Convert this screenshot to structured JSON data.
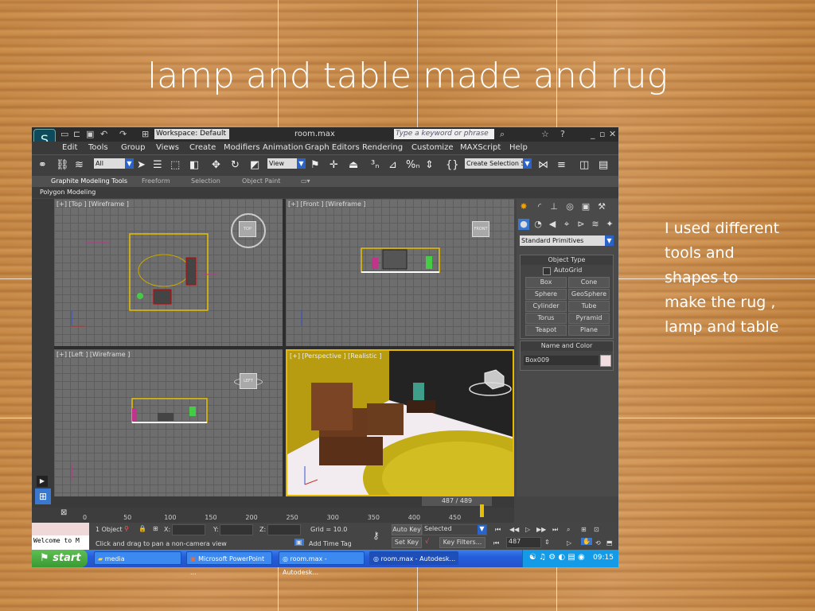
{
  "slide": {
    "title": "lamp and table made and rug",
    "note": "I used different tools and shapes to make the rug , lamp and table"
  },
  "app": {
    "workspace": "Workspace: Default",
    "title": "room.max",
    "search_placeholder": "Type a keyword or phrase",
    "menu": [
      "Edit",
      "Tools",
      "Group",
      "Views",
      "Create",
      "Modifiers",
      "Animation",
      "Graph Editors",
      "Rendering",
      "Customize",
      "MAXScript",
      "Help"
    ],
    "selection_filter": "All",
    "ref_coord": "View",
    "named_selection": "Create Selection Se",
    "ribbon_tabs": [
      "Graphite Modeling Tools",
      "Freeform",
      "Selection",
      "Object Paint"
    ],
    "ribbon_sub": "Polygon Modeling"
  },
  "viewports": {
    "top": "[+] [Top ] [Wireframe ]",
    "front": "[+] [Front ] [Wireframe ]",
    "left": "[+] [Left ] [Wireframe ]",
    "perspective": "[+] [Perspective ] [Realistic ]",
    "cube_top": "TOP",
    "cube_front": "FRONT",
    "cube_left": "LEFT"
  },
  "command_panel": {
    "category": "Standard Primitives",
    "object_type_title": "Object Type",
    "autogrid": "AutoGrid",
    "primitives": [
      "Box",
      "Cone",
      "Sphere",
      "GeoSphere",
      "Cylinder",
      "Tube",
      "Torus",
      "Pyramid",
      "Teapot",
      "Plane"
    ],
    "name_color_title": "Name and Color",
    "object_name": "Box009"
  },
  "timeline": {
    "frame": "487 / 489",
    "ticks": [
      "0",
      "50",
      "100",
      "150",
      "200",
      "250",
      "300",
      "350",
      "400",
      "450"
    ]
  },
  "status": {
    "selected": "1 Object",
    "x_label": "X:",
    "y_label": "Y:",
    "z_label": "Z:",
    "grid": "Grid = 10.0",
    "prompt": "Click and drag to pan a non-camera view",
    "add_time_tag": "Add Time Tag",
    "auto_key": "Auto Key",
    "key_mode": "Selected",
    "set_key": "Set Key",
    "key_filters": "Key Filters...",
    "current_frame": "487",
    "listener": "Welcome to M"
  },
  "taskbar": {
    "start": "start",
    "tasks": [
      "media",
      "Microsoft PowerPoint ...",
      "room.max - Autodesk...",
      "room.max - Autodesk..."
    ],
    "clock": "09:15"
  },
  "colors": {
    "accent": "#e6b800",
    "taskbar": "#245edc"
  }
}
